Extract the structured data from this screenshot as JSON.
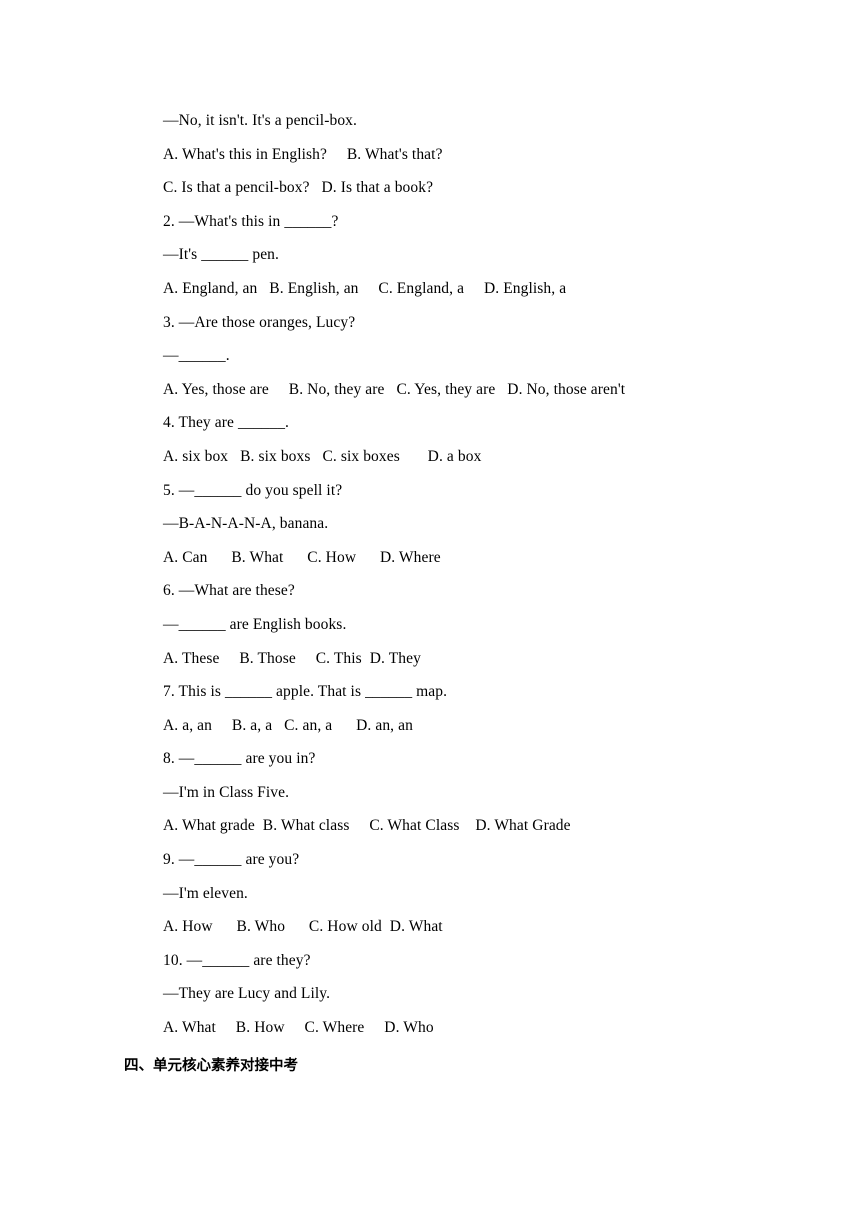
{
  "document": {
    "lines": [
      "—No, it isn't. It's a pencil-box.",
      "A. What's this in English?     B. What's that?",
      "C. Is that a pencil-box?   D. Is that a book?",
      "2. —What's this in ______?",
      "—It's ______ pen.",
      "A. England, an   B. English, an     C. England, a     D. English, a",
      "3. —Are those oranges, Lucy?",
      "—______.",
      "A. Yes, those are     B. No, they are   C. Yes, they are   D. No, those aren't",
      "4. They are ______.",
      "A. six box   B. six boxs   C. six boxes       D. a box",
      "5. —______ do you spell it?",
      "—B-A-N-A-N-A, banana.",
      "A. Can      B. What      C. How      D. Where",
      "6. —What are these?",
      "—______ are English books.",
      "A. These     B. Those     C. This  D. They",
      "7. This is ______ apple. That is ______ map.",
      "A. a, an     B. a, a   C. an, a      D. an, an",
      "8. —______ are you in?",
      "—I'm in Class Five.",
      "A. What grade  B. What class     C. What Class    D. What Grade",
      "9. —______ are you?",
      "—I'm eleven.",
      "A. How      B. Who      C. How old  D. What",
      "10. —______ are they?",
      "—They are Lucy and Lily.",
      "A. What     B. How     C. Where     D. Who"
    ],
    "section_heading": "四、单元核心素养对接中考"
  }
}
